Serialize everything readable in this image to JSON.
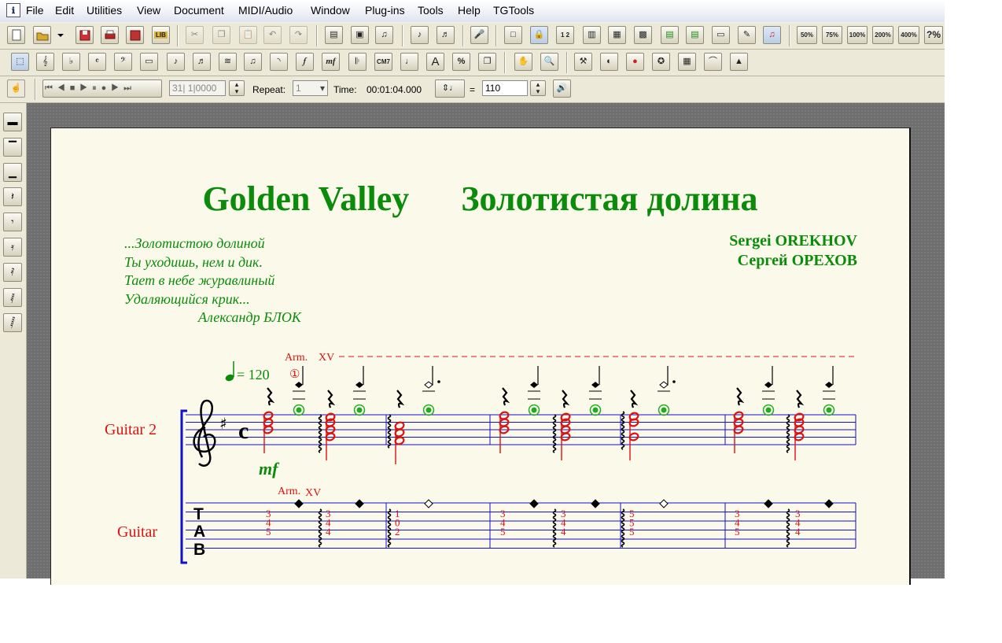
{
  "menu": [
    "File",
    "Edit",
    "Utilities",
    "View",
    "Document",
    "MIDI/Audio",
    "Window",
    "Plug-ins",
    "Tools",
    "Help",
    "TGTools"
  ],
  "app_icon_label": "ℹ",
  "toolbar1": {
    "zoom": [
      "50%",
      "75%",
      "100%",
      "200%",
      "400%",
      "?%"
    ]
  },
  "toolbar2": {
    "labels": [
      "mf",
      "CM7",
      "A",
      "%"
    ]
  },
  "transport": {
    "position": "31| 1|0000",
    "repeat_label": "Repeat:",
    "repeat_value": "1",
    "time_label": "Time:",
    "time_value": "00:01:04.000",
    "equals": "=",
    "tempo_value": "110"
  },
  "document": {
    "title": "Golden Valley      Золотистая долина",
    "poem": [
      "...Золотистою долиной",
      "Ты уходишь, нем и дик.",
      "Тает в небе журавлиный",
      "Удаляющийся крик...",
      "Александр БЛОК"
    ],
    "composer_latin": "Sergei OREKHOV",
    "composer_cyrillic": "Сергей ОРЕХОВ",
    "tempo_marking": "= 120",
    "arm_top": "Arm.",
    "arm_top_fret": "XV",
    "string_number": "①",
    "time_signature": "c",
    "dynamic": "mf",
    "arm_tab": "Arm.",
    "arm_tab_fret": "XV",
    "staff_name_top": "Guitar 2",
    "staff_name_tab": "Guitar",
    "tab_clef": [
      "T",
      "A",
      "B"
    ],
    "tab_columns": [
      [
        "3",
        "4",
        "5"
      ],
      [
        "3",
        "4",
        "4"
      ],
      [
        "1",
        "0",
        "2"
      ],
      [
        "3",
        "4",
        "5"
      ],
      [
        "3",
        "4",
        "4"
      ],
      [
        "5",
        "5",
        "5"
      ],
      [
        "3",
        "4",
        "5"
      ],
      [
        "3",
        "4",
        "4"
      ]
    ]
  },
  "colors": {
    "title_green": "#0a8c0a",
    "note_red": "#dd1111",
    "staff_blue": "#1111cc",
    "harmonic_green": "#22aa22"
  }
}
